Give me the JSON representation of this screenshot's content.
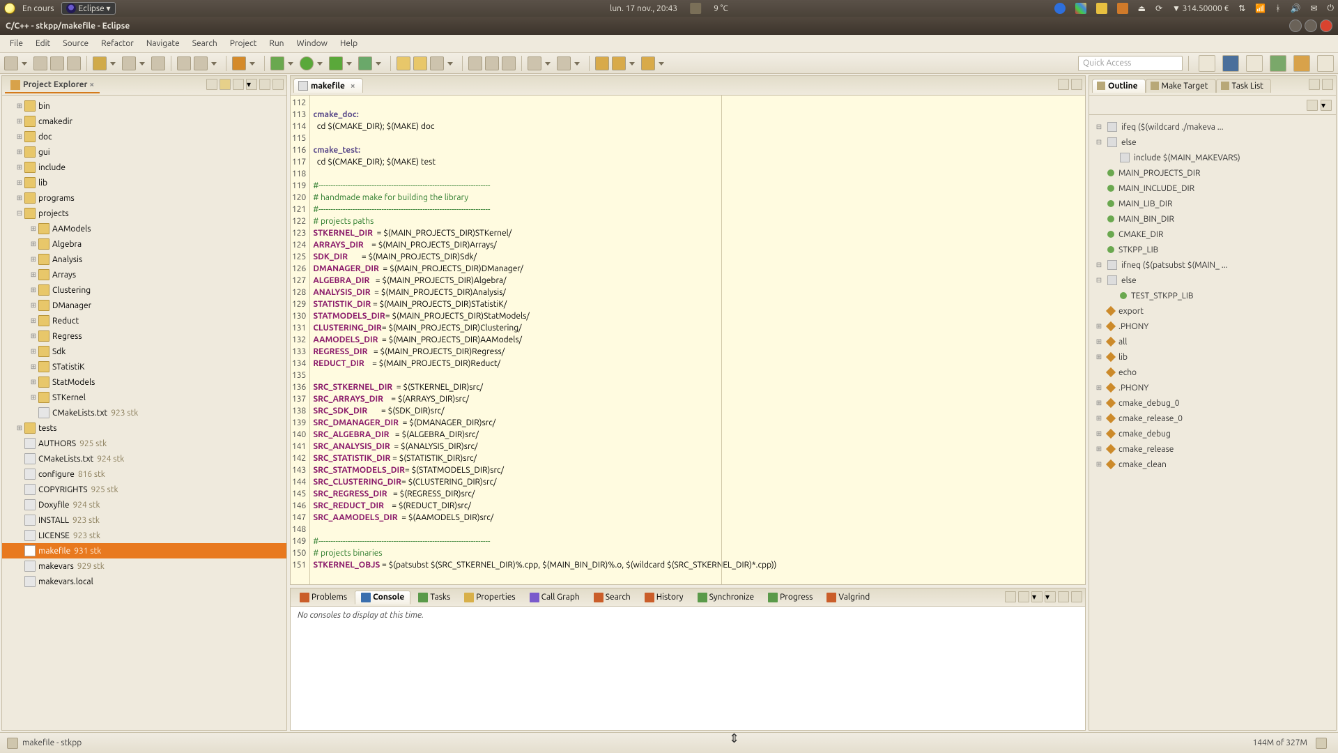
{
  "system_bar": {
    "left_items": [
      "En cours",
      "Eclipse ▾"
    ],
    "center_items": [
      "lun. 17 nov., 20:43",
      "9 °C"
    ],
    "right_items": [
      "▼ 314.50000 €"
    ]
  },
  "window_title": "C/C++ - stkpp/makefile - Eclipse",
  "menus": [
    "File",
    "Edit",
    "Source",
    "Refactor",
    "Navigate",
    "Search",
    "Project",
    "Run",
    "Window",
    "Help"
  ],
  "quick_access_placeholder": "Quick Access",
  "project_explorer": {
    "title": "Project Explorer",
    "tree": [
      {
        "depth": 1,
        "expander": "⊞",
        "icon": "folder",
        "label": "bin"
      },
      {
        "depth": 1,
        "expander": "⊞",
        "icon": "folder",
        "label": "cmakedir"
      },
      {
        "depth": 1,
        "expander": "⊞",
        "icon": "folder",
        "label": "doc"
      },
      {
        "depth": 1,
        "expander": "⊞",
        "icon": "folder",
        "label": "gui"
      },
      {
        "depth": 1,
        "expander": "⊞",
        "icon": "folder",
        "label": "include"
      },
      {
        "depth": 1,
        "expander": "⊞",
        "icon": "folder",
        "label": "lib"
      },
      {
        "depth": 1,
        "expander": "⊞",
        "icon": "folder",
        "label": "programs"
      },
      {
        "depth": 1,
        "expander": "⊟",
        "icon": "folder",
        "label": "projects"
      },
      {
        "depth": 2,
        "expander": "⊞",
        "icon": "folder",
        "label": "AAModels"
      },
      {
        "depth": 2,
        "expander": "⊞",
        "icon": "folder",
        "label": "Algebra"
      },
      {
        "depth": 2,
        "expander": "⊞",
        "icon": "folder",
        "label": "Analysis"
      },
      {
        "depth": 2,
        "expander": "⊞",
        "icon": "folder",
        "label": "Arrays"
      },
      {
        "depth": 2,
        "expander": "⊞",
        "icon": "folder",
        "label": "Clustering"
      },
      {
        "depth": 2,
        "expander": "⊞",
        "icon": "folder",
        "label": "DManager"
      },
      {
        "depth": 2,
        "expander": "⊞",
        "icon": "folder",
        "label": "Reduct"
      },
      {
        "depth": 2,
        "expander": "⊞",
        "icon": "folder",
        "label": "Regress"
      },
      {
        "depth": 2,
        "expander": "⊞",
        "icon": "folder",
        "label": "Sdk"
      },
      {
        "depth": 2,
        "expander": "⊞",
        "icon": "folder",
        "label": "STatistiK"
      },
      {
        "depth": 2,
        "expander": "⊞",
        "icon": "folder",
        "label": "StatModels"
      },
      {
        "depth": 2,
        "expander": "⊞",
        "icon": "folder",
        "label": "STKernel"
      },
      {
        "depth": 2,
        "expander": "",
        "icon": "file",
        "label": "CMakeLists.txt",
        "rev": "923  stk"
      },
      {
        "depth": 1,
        "expander": "⊞",
        "icon": "folder",
        "label": "tests"
      },
      {
        "depth": 1,
        "expander": "",
        "icon": "file",
        "label": "AUTHORS",
        "rev": "925  stk"
      },
      {
        "depth": 1,
        "expander": "",
        "icon": "file",
        "label": "CMakeLists.txt",
        "rev": "924  stk"
      },
      {
        "depth": 1,
        "expander": "",
        "icon": "file",
        "label": "configure",
        "rev": "816  stk"
      },
      {
        "depth": 1,
        "expander": "",
        "icon": "file",
        "label": "COPYRIGHTS",
        "rev": "925  stk"
      },
      {
        "depth": 1,
        "expander": "",
        "icon": "file",
        "label": "Doxyfile",
        "rev": "924  stk"
      },
      {
        "depth": 1,
        "expander": "",
        "icon": "file",
        "label": "INSTALL",
        "rev": "923  stk"
      },
      {
        "depth": 1,
        "expander": "",
        "icon": "file",
        "label": "LICENSE",
        "rev": "923  stk"
      },
      {
        "depth": 1,
        "expander": "",
        "icon": "file",
        "label": "makefile",
        "rev": "931  stk",
        "selected": true
      },
      {
        "depth": 1,
        "expander": "",
        "icon": "file",
        "label": "makevars",
        "rev": "929  stk"
      },
      {
        "depth": 1,
        "expander": "",
        "icon": "file",
        "label": "makevars.local"
      }
    ]
  },
  "editor": {
    "tab_label": "makefile",
    "first_line_no": 112,
    "lines": [
      {
        "t": "",
        "c": ""
      },
      {
        "t": "tg",
        "c": "cmake_doc:"
      },
      {
        "t": "",
        "c": "  cd $(CMAKE_DIR); $(MAKE) doc"
      },
      {
        "t": "",
        "c": ""
      },
      {
        "t": "tg",
        "c": "cmake_test:"
      },
      {
        "t": "",
        "c": "  cd $(CMAKE_DIR); $(MAKE) test"
      },
      {
        "t": "",
        "c": ""
      },
      {
        "t": "cm",
        "c": "#-----------------------------------------------------------------------"
      },
      {
        "t": "cm",
        "c": "# handmade make for building the library"
      },
      {
        "t": "cm",
        "c": "#-----------------------------------------------------------------------"
      },
      {
        "t": "cm",
        "c": "# projects paths"
      },
      {
        "t": "asg",
        "lhs": "STKERNEL_DIR ",
        "rhs": " = $(MAIN_PROJECTS_DIR)STKernel/"
      },
      {
        "t": "asg",
        "lhs": "ARRAYS_DIR   ",
        "rhs": " = $(MAIN_PROJECTS_DIR)Arrays/"
      },
      {
        "t": "asg",
        "lhs": "SDK_DIR      ",
        "rhs": " = $(MAIN_PROJECTS_DIR)Sdk/"
      },
      {
        "t": "asg",
        "lhs": "DMANAGER_DIR ",
        "rhs": " = $(MAIN_PROJECTS_DIR)DManager/"
      },
      {
        "t": "asg",
        "lhs": "ALGEBRA_DIR  ",
        "rhs": " = $(MAIN_PROJECTS_DIR)Algebra/"
      },
      {
        "t": "asg",
        "lhs": "ANALYSIS_DIR ",
        "rhs": " = $(MAIN_PROJECTS_DIR)Analysis/"
      },
      {
        "t": "asg",
        "lhs": "STATISTIK_DIR",
        "rhs": " = $(MAIN_PROJECTS_DIR)STatistiK/"
      },
      {
        "t": "asg",
        "lhs": "STATMODELS_DIR",
        "rhs": "= $(MAIN_PROJECTS_DIR)StatModels/"
      },
      {
        "t": "asg",
        "lhs": "CLUSTERING_DIR",
        "rhs": "= $(MAIN_PROJECTS_DIR)Clustering/"
      },
      {
        "t": "asg",
        "lhs": "AAMODELS_DIR ",
        "rhs": " = $(MAIN_PROJECTS_DIR)AAModels/"
      },
      {
        "t": "asg",
        "lhs": "REGRESS_DIR  ",
        "rhs": " = $(MAIN_PROJECTS_DIR)Regress/"
      },
      {
        "t": "asg",
        "lhs": "REDUCT_DIR   ",
        "rhs": " = $(MAIN_PROJECTS_DIR)Reduct/"
      },
      {
        "t": "",
        "c": ""
      },
      {
        "t": "asg",
        "lhs": "SRC_STKERNEL_DIR ",
        "rhs": " = $(STKERNEL_DIR)src/"
      },
      {
        "t": "asg",
        "lhs": "SRC_ARRAYS_DIR   ",
        "rhs": " = $(ARRAYS_DIR)src/"
      },
      {
        "t": "asg",
        "lhs": "SRC_SDK_DIR      ",
        "rhs": " = $(SDK_DIR)src/"
      },
      {
        "t": "asg",
        "lhs": "SRC_DMANAGER_DIR ",
        "rhs": " = $(DMANAGER_DIR)src/"
      },
      {
        "t": "asg",
        "lhs": "SRC_ALGEBRA_DIR  ",
        "rhs": " = $(ALGEBRA_DIR)src/"
      },
      {
        "t": "asg",
        "lhs": "SRC_ANALYSIS_DIR ",
        "rhs": " = $(ANALYSIS_DIR)src/"
      },
      {
        "t": "asg",
        "lhs": "SRC_STATISTIK_DIR",
        "rhs": " = $(STATISTIK_DIR)src/"
      },
      {
        "t": "asg",
        "lhs": "SRC_STATMODELS_DIR",
        "rhs": "= $(STATMODELS_DIR)src/"
      },
      {
        "t": "asg",
        "lhs": "SRC_CLUSTERING_DIR",
        "rhs": "= $(CLUSTERING_DIR)src/"
      },
      {
        "t": "asg",
        "lhs": "SRC_REGRESS_DIR  ",
        "rhs": " = $(REGRESS_DIR)src/"
      },
      {
        "t": "asg",
        "lhs": "SRC_REDUCT_DIR   ",
        "rhs": " = $(REDUCT_DIR)src/"
      },
      {
        "t": "asg",
        "lhs": "SRC_AAMODELS_DIR ",
        "rhs": " = $(AAMODELS_DIR)src/"
      },
      {
        "t": "",
        "c": ""
      },
      {
        "t": "cm",
        "c": "#-----------------------------------------------------------------------"
      },
      {
        "t": "cm",
        "c": "# projects binaries"
      },
      {
        "t": "asg",
        "lhs": "STKERNEL_OBJS",
        "rhs": " = $(patsubst $(SRC_STKERNEL_DIR)%.cpp, $(MAIN_BIN_DIR)%.o, $(wildcard $(SRC_STKERNEL_DIR)*.cpp))"
      }
    ]
  },
  "outline": {
    "tabs": [
      "Outline",
      "Make Target",
      "Task List"
    ],
    "items": [
      {
        "exp": "⊟",
        "k": "oicon",
        "label": "ifeq ($(wildcard ./makeva ..."
      },
      {
        "exp": "⊟",
        "k": "oicon",
        "label": "else"
      },
      {
        "exp": "",
        "k": "oicon",
        "label": "include $(MAIN_MAKEVARS)",
        "indent": 1
      },
      {
        "exp": "",
        "k": "dot",
        "label": "MAIN_PROJECTS_DIR"
      },
      {
        "exp": "",
        "k": "dot",
        "label": "MAIN_INCLUDE_DIR"
      },
      {
        "exp": "",
        "k": "dot",
        "label": "MAIN_LIB_DIR"
      },
      {
        "exp": "",
        "k": "dot",
        "label": "MAIN_BIN_DIR"
      },
      {
        "exp": "",
        "k": "dot",
        "label": "CMAKE_DIR"
      },
      {
        "exp": "",
        "k": "dot",
        "label": "STKPP_LIB"
      },
      {
        "exp": "⊟",
        "k": "oicon",
        "label": "ifneq ($(patsubst $(MAIN_ ..."
      },
      {
        "exp": "⊟",
        "k": "oicon",
        "label": "else"
      },
      {
        "exp": "",
        "k": "dot",
        "label": "TEST_STKPP_LIB",
        "indent": 1
      },
      {
        "exp": "",
        "k": "diam",
        "label": "export"
      },
      {
        "exp": "⊞",
        "k": "diam",
        "label": ".PHONY"
      },
      {
        "exp": "⊞",
        "k": "diam",
        "label": "all"
      },
      {
        "exp": "⊞",
        "k": "diam",
        "label": "lib"
      },
      {
        "exp": "",
        "k": "diam",
        "label": "echo"
      },
      {
        "exp": "⊞",
        "k": "diam",
        "label": ".PHONY"
      },
      {
        "exp": "⊞",
        "k": "diam",
        "label": "cmake_debug_0"
      },
      {
        "exp": "⊞",
        "k": "diam",
        "label": "cmake_release_0"
      },
      {
        "exp": "⊞",
        "k": "diam",
        "label": "cmake_debug"
      },
      {
        "exp": "⊞",
        "k": "diam",
        "label": "cmake_release"
      },
      {
        "exp": "⊞",
        "k": "diam",
        "label": "cmake_clean"
      }
    ]
  },
  "bottom_panel": {
    "tabs": [
      "Problems",
      "Console",
      "Tasks",
      "Properties",
      "Call Graph",
      "Search",
      "History",
      "Synchronize",
      "Progress",
      "Valgrind"
    ],
    "active_tab": "Console",
    "message": "No consoles to display at this time."
  },
  "statusbar": {
    "left": "makefile - stkpp",
    "heap": "144M of 327M"
  }
}
